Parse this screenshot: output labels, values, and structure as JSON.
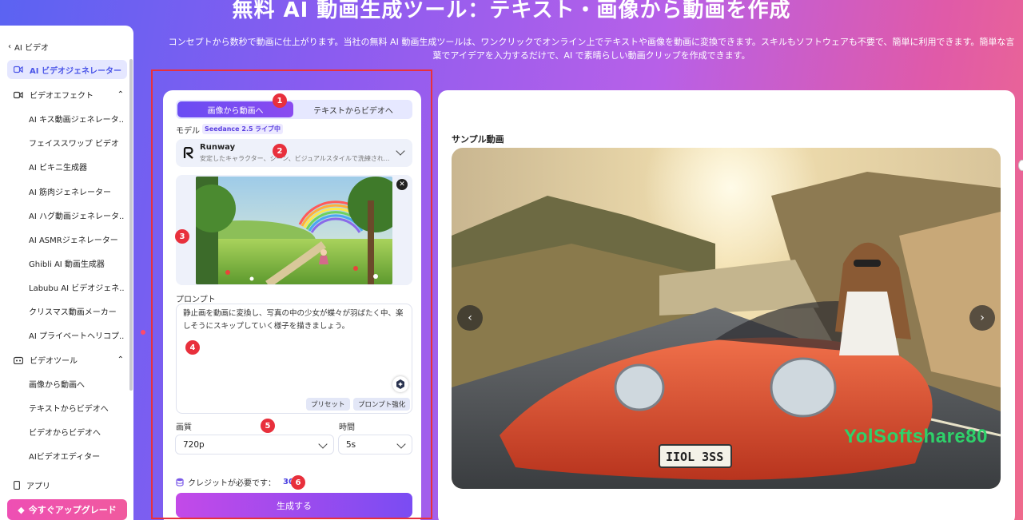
{
  "hero": {
    "title": "無料 AI 動画生成ツール：テキスト・画像から動画を作成",
    "description": "コンセプトから数秒で動画に仕上がります。当社の無料 AI 動画生成ツールは、ワンクリックでオンライン上でテキストや画像を動画に変換できます。スキルもソフトウェアも不要で、簡単に利用できます。簡単な言葉でアイデアを入力するだけで、AI で素晴らしい動画クリップを作成できます。"
  },
  "sidebar": {
    "back_label": "AI ビデオ",
    "active_label": "AI ビデオジェネレーター",
    "group1_label": "ビデオエフェクト",
    "group1_items": [
      "AI キス動画ジェネレータ...",
      "フェイススワップ ビデオ",
      "AI ビキニ生成器",
      "AI 筋肉ジェネレーター",
      "AI ハグ動画ジェネレータ...",
      "AI ASMRジェネレーター",
      "Ghibli AI 動画生成器",
      "Labubu AI ビデオジェネ...",
      "クリスマス動画メーカー",
      "AI プライベートヘリコプ..."
    ],
    "group2_label": "ビデオツール",
    "group2_items": [
      "画像から動画へ",
      "テキストからビデオへ",
      "ビデオからビデオへ",
      "AIビデオエディター"
    ],
    "app_label": "アプリ",
    "upgrade_label": "今すぐアップグレード"
  },
  "form": {
    "tab_image": "画像から動画へ",
    "tab_text": "テキストからビデオへ",
    "model_label": "モデル",
    "model_badge1": "Seedance 2.5",
    "model_badge2": "ライブ中",
    "model_name": "Runway",
    "model_desc": "安定したキャラクター、シーン、ビジュアルスタイルで洗練され...",
    "prompt_label": "プロンプト",
    "prompt_text": "静止画を動画に変換し、写真の中の少女が蝶々が羽ばたく中、楽しそうにスキップしていく様子を描きましょう。",
    "preset_label": "プリセット",
    "enhance_label": "プロンプト強化",
    "quality_label": "画質",
    "quality_value": "720p",
    "duration_label": "時間",
    "duration_value": "5s",
    "credits_label": "クレジットが必要です：",
    "credits_value": "30",
    "generate_label": "生成する"
  },
  "badges": [
    "1",
    "2",
    "3",
    "4",
    "5",
    "6"
  ],
  "preview": {
    "title": "サンプル動画",
    "watermark": "YolSoftshare80",
    "plate": "IIOL 3SS"
  },
  "colors": {
    "accent": "#6a4cf3",
    "annotation": "#e8303c",
    "watermark": "#2ed16a"
  }
}
